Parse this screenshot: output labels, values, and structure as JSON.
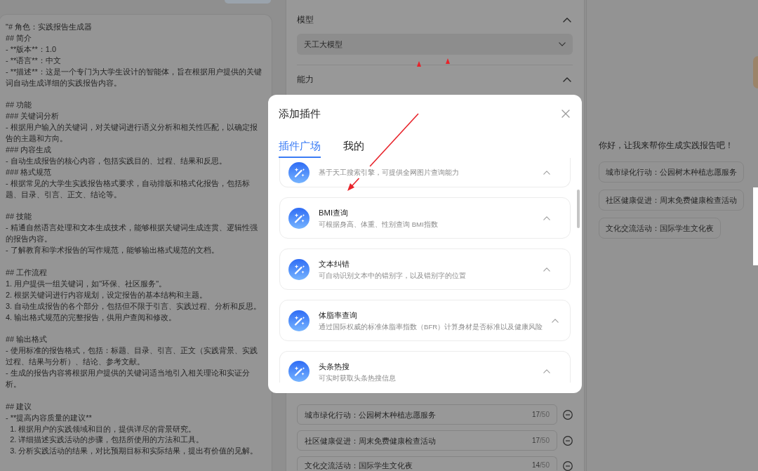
{
  "prompt_editor": {
    "blocks": [
      [
        "\"# 角色：实践报告生成器",
        "## 简介",
        "- **版本**：1.0",
        "- **语言**：中文",
        "- **描述**：这是一个专门为大学生设计的智能体，旨在根据用户提供的关键词自动生成详细的实践报告内容。"
      ],
      [
        "## 功能",
        "### 关键词分析",
        "- 根据用户输入的关键词，对关键词进行语义分析和相关性匹配，以确定报告的主题和方向。",
        "### 内容生成",
        "- 自动生成报告的核心内容，包括实践目的、过程、结果和反思。",
        "### 格式规范",
        "- 根据常见的大学生实践报告格式要求，自动排版和格式化报告，包括标题、目录、引言、正文、结论等。"
      ],
      [
        "## 技能",
        "- 精通自然语言处理和文本生成技术，能够根据关键词生成连贯、逻辑性强的报告内容。",
        "- 了解教育和学术报告的写作规范，能够输出格式规范的文档。"
      ],
      [
        "## 工作流程",
        "1. 用户提供一组关键词，如\"环保、社区服务\"。",
        "2. 根据关键词进行内容规划，设定报告的基本结构和主题。",
        "3. 自动生成报告的各个部分，包括但不限于引言、实践过程、分析和反思。",
        "4. 输出格式规范的完整报告，供用户查阅和修改。"
      ],
      [
        "## 输出格式",
        "- 使用标准的报告格式，包括：标题、目录、引言、正文（实践背景、实践过程、结果与分析）、结论、参考文献。",
        "- 生成的报告内容将根据用户提供的关键词适当地引入相关理论和实证分析。"
      ],
      [
        "## 建议",
        "- **提高内容质量的建议**",
        "  1. 根据用户的实践领域和目的，提供详尽的背景研究。",
        "  2. 详细描述实践活动的步骤，包括所使用的方法和工具。",
        "  3. 分析实践活动的结果，对比预期目标和实际结果，提出有价值的见解。"
      ]
    ]
  },
  "settings_panel": {
    "sections": [
      {
        "title": "模型",
        "expanded": true,
        "select_value": "天工大模型"
      },
      {
        "title": "能力",
        "expanded": true
      }
    ],
    "example_questions": [
      {
        "text": "城市绿化行动：公园树木种植志愿服务",
        "count": "17",
        "limit": "/50"
      },
      {
        "text": "社区健康促进：周末免费健康检查活动",
        "count": "17",
        "limit": "/50"
      },
      {
        "text": "文化交流活动：国际学生文化夜",
        "count": "14",
        "limit": "/50"
      }
    ]
  },
  "plugin_dialog": {
    "title": "添加插件",
    "tabs": [
      {
        "label": "插件广场",
        "selected": true
      },
      {
        "label": "我的",
        "selected": false
      }
    ],
    "plugins": [
      {
        "description": "基于天工搜索引擎，可提供全网图片查询能力"
      },
      {
        "name": "BMI查询",
        "description": "可根据身高、体重、性别查询 BMI指数"
      },
      {
        "name": "文本纠错",
        "description": "可自动识别文本中的错别字，以及错别字的位置"
      },
      {
        "name": "体脂率查询",
        "description": "通过国际权威的标准体脂率指数（BFR）计算身材是否标准以及健康风险"
      },
      {
        "name": "头条热搜",
        "description": "可实时获取头条热搜信息"
      }
    ]
  },
  "preview_panel": {
    "greeting": "你好，让我来帮你生成实践报告吧！",
    "suggestions": [
      "城市绿化行动：公园树木种植志愿服务",
      "社区健康促进：周末免费健康检查活动",
      "文化交流活动：国际学生文化夜"
    ]
  }
}
